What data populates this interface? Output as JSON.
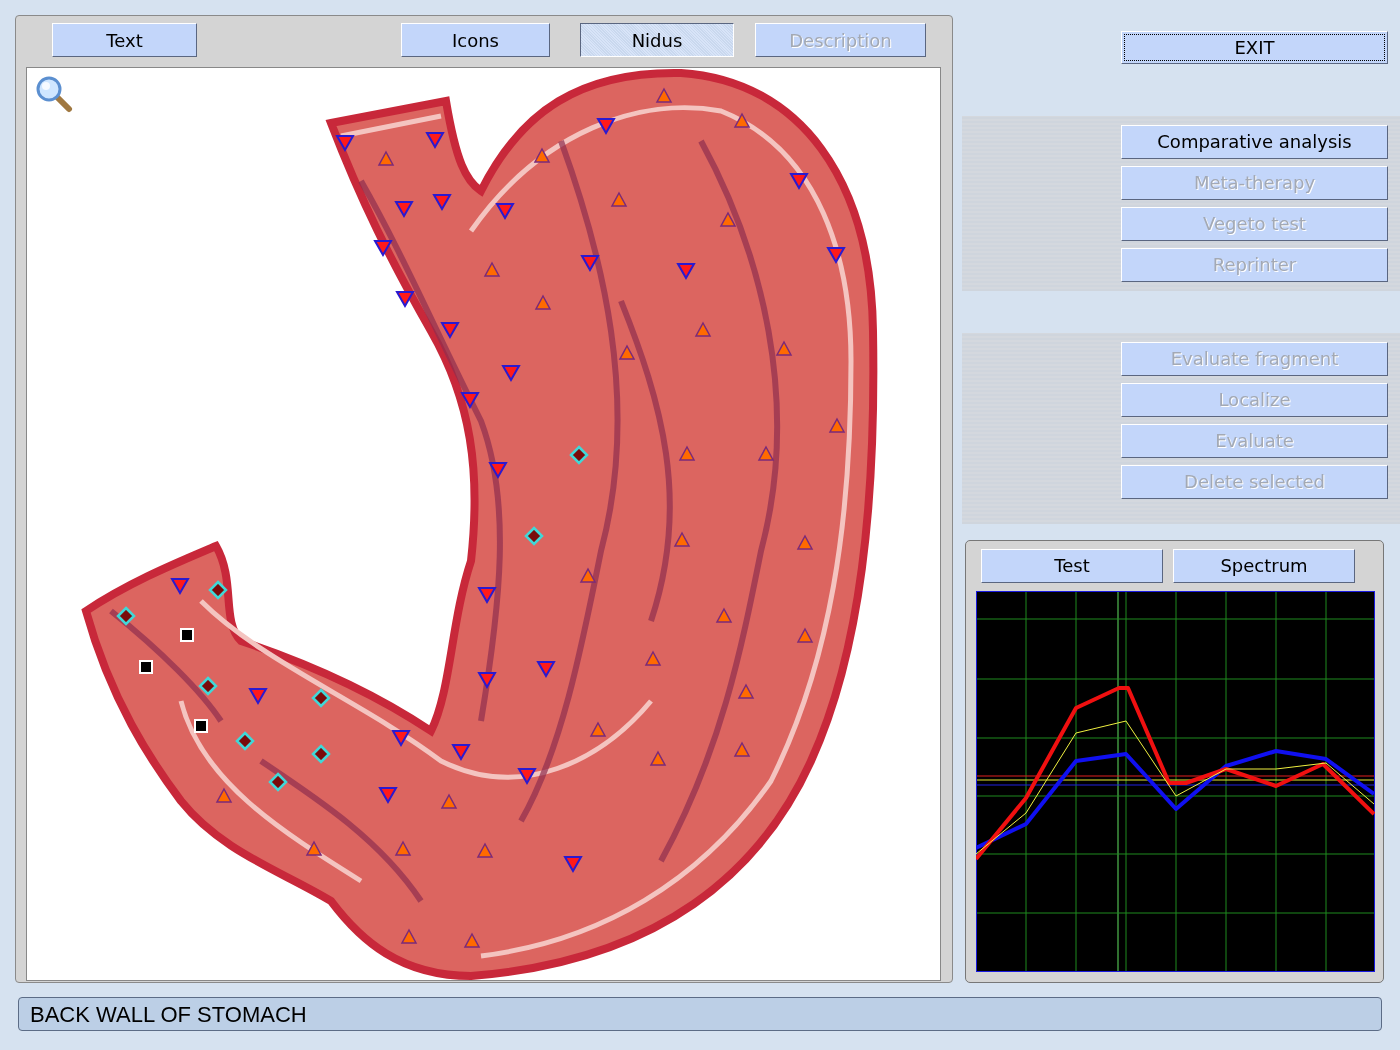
{
  "view_tabs": [
    {
      "label": "Text",
      "selected": false,
      "disabled": false
    },
    {
      "label": "Icons",
      "selected": false,
      "disabled": false
    },
    {
      "label": "Nidus",
      "selected": true,
      "disabled": false
    },
    {
      "label": "Description",
      "selected": false,
      "disabled": true
    }
  ],
  "exit_button": {
    "label": "EXIT",
    "focused": true
  },
  "analysis_buttons": [
    {
      "label": "Comparative analysis",
      "disabled": false
    },
    {
      "label": "Meta-therapy",
      "disabled": true
    },
    {
      "label": "Vegeto test",
      "disabled": true
    },
    {
      "label": "Reprinter",
      "disabled": true
    }
  ],
  "fragment_buttons": [
    {
      "label": "Evaluate fragment",
      "disabled": true
    },
    {
      "label": "Localize",
      "disabled": true
    },
    {
      "label": "Evaluate",
      "disabled": true
    },
    {
      "label": "Delete selected",
      "disabled": true
    }
  ],
  "graph_tabs": [
    {
      "label": "Test"
    },
    {
      "label": "Spectrum"
    }
  ],
  "status_bar": {
    "text": "BACK WALL OF STOMACH"
  }
}
